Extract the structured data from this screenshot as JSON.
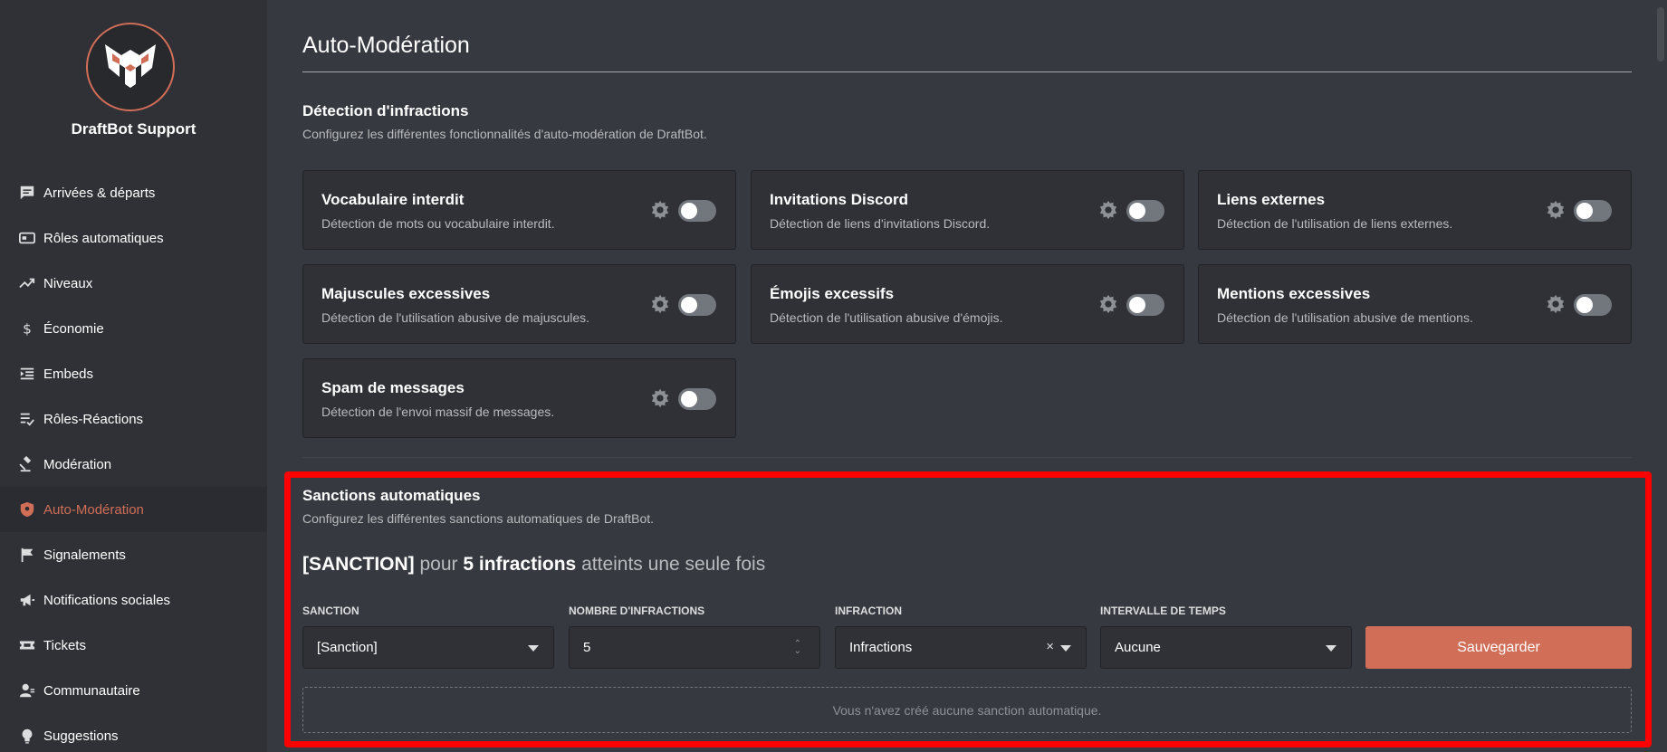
{
  "sidebar": {
    "server_name": "DraftBot Support",
    "items": [
      {
        "label": "Arrivées & départs",
        "icon": "chat-icon"
      },
      {
        "label": "Rôles automatiques",
        "icon": "id-card-icon"
      },
      {
        "label": "Niveaux",
        "icon": "trend-up-icon"
      },
      {
        "label": "Économie",
        "icon": "dollar-icon"
      },
      {
        "label": "Embeds",
        "icon": "indent-icon"
      },
      {
        "label": "Rôles-Réactions",
        "icon": "list-check-icon"
      },
      {
        "label": "Modération",
        "icon": "gavel-icon"
      },
      {
        "label": "Auto-Modération",
        "icon": "shield-icon",
        "active": true
      },
      {
        "label": "Signalements",
        "icon": "flag-icon"
      },
      {
        "label": "Notifications sociales",
        "icon": "megaphone-icon"
      },
      {
        "label": "Tickets",
        "icon": "ticket-icon"
      },
      {
        "label": "Communautaire",
        "icon": "users-icon"
      },
      {
        "label": "Suggestions",
        "icon": "lightbulb-icon"
      }
    ]
  },
  "page": {
    "title": "Auto-Modération"
  },
  "detection": {
    "title": "Détection d'infractions",
    "description": "Configurez les différentes fonctionnalités d'auto-modération de DraftBot.",
    "cards": [
      {
        "title": "Vocabulaire interdit",
        "description": "Détection de mots ou vocabulaire interdit.",
        "enabled": false
      },
      {
        "title": "Invitations Discord",
        "description": "Détection de liens d'invitations Discord.",
        "enabled": false
      },
      {
        "title": "Liens externes",
        "description": "Détection de l'utilisation de liens externes.",
        "enabled": false
      },
      {
        "title": "Majuscules excessives",
        "description": "Détection de l'utilisation abusive de majuscules.",
        "enabled": false
      },
      {
        "title": "Émojis excessifs",
        "description": "Détection de l'utilisation abusive d'émojis.",
        "enabled": false
      },
      {
        "title": "Mentions excessives",
        "description": "Détection de l'utilisation abusive de mentions.",
        "enabled": false
      },
      {
        "title": "Spam de messages",
        "description": "Détection de l'envoi massif de messages.",
        "enabled": false
      }
    ]
  },
  "sanctions": {
    "title": "Sanctions automatiques",
    "description": "Configurez les différentes sanctions automatiques de DraftBot.",
    "summary": {
      "sanction": "[SANCTION]",
      "word_pour": "pour",
      "count_text": "5 infractions",
      "tail": "atteints une seule fois"
    },
    "fields": {
      "sanction_label": "SANCTION",
      "sanction_value": "[Sanction]",
      "count_label": "NOMBRE D'INFRACTIONS",
      "count_value": "5",
      "infraction_label": "INFRACTION",
      "infraction_value": "Infractions",
      "interval_label": "INTERVALLE DE TEMPS",
      "interval_value": "Aucune"
    },
    "save_label": "Sauvegarder",
    "empty_text": "Vous n'avez créé aucune sanction automatique."
  },
  "colors": {
    "accent": "#d16e57",
    "highlight": "#ff0000",
    "background": "#36393f",
    "sidebar": "#2f3136"
  }
}
